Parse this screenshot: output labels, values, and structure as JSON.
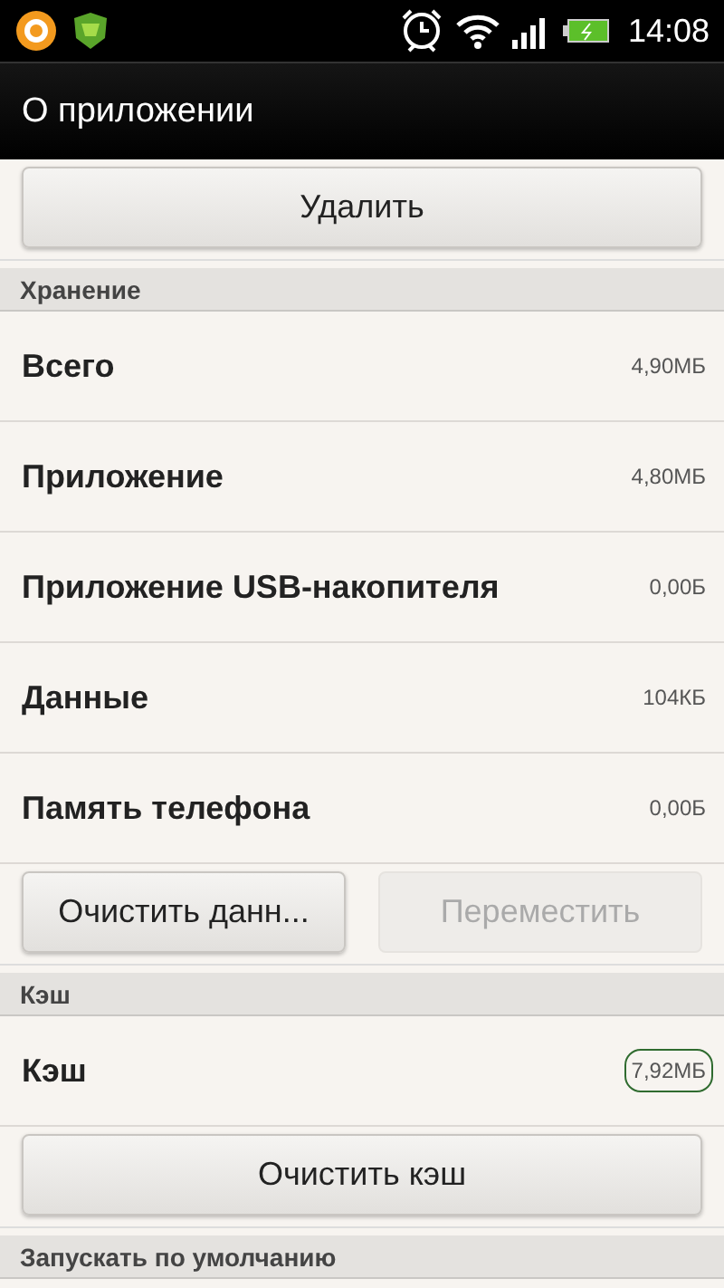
{
  "status_bar": {
    "time": "14:08"
  },
  "title_bar": {
    "title": "О приложении"
  },
  "sections": [
    {
      "kind": "button",
      "button": {
        "label": "Удалить",
        "disabled": false
      }
    },
    {
      "kind": "header",
      "title": "Хранение"
    },
    {
      "kind": "rows",
      "rows": [
        {
          "label": "Всего",
          "value": "4,90МБ",
          "highlighted": false
        },
        {
          "label": "Приложение",
          "value": "4,80МБ",
          "highlighted": false
        },
        {
          "label": "Приложение USB-накопителя",
          "value": "0,00Б",
          "highlighted": false
        },
        {
          "label": "Данные",
          "value": "104КБ",
          "highlighted": false
        },
        {
          "label": "Память телефона",
          "value": "0,00Б",
          "highlighted": false
        }
      ]
    },
    {
      "kind": "button_pair",
      "buttons": [
        {
          "label": "Очистить данн...",
          "disabled": false
        },
        {
          "label": "Переместить",
          "disabled": true
        }
      ]
    },
    {
      "kind": "header",
      "title": "Кэш"
    },
    {
      "kind": "rows",
      "rows": [
        {
          "label": "Кэш",
          "value": "7,92МБ",
          "highlighted": true
        }
      ]
    },
    {
      "kind": "button",
      "button": {
        "label": "Очистить кэш",
        "disabled": false
      }
    },
    {
      "kind": "header",
      "title": "Запускать по умолчанию"
    }
  ]
}
